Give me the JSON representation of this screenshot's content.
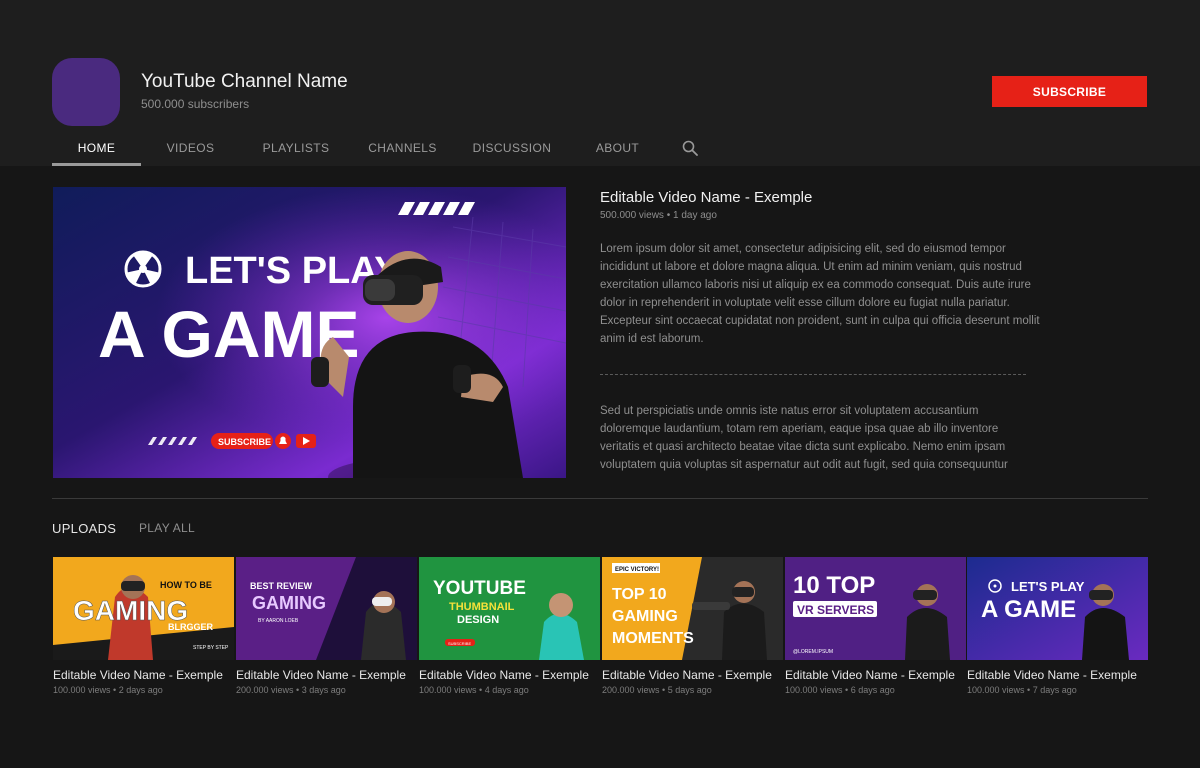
{
  "channel": {
    "name": "YouTube Channel Name",
    "subscribers": "500.000 subscribers",
    "subscribe_label": "SUBSCRIBE",
    "avatar_color": "#4a2a7f"
  },
  "tabs": [
    {
      "label": "HOME",
      "active": true
    },
    {
      "label": "VIDEOS",
      "active": false
    },
    {
      "label": "PLAYLISTS",
      "active": false
    },
    {
      "label": "CHANNELS",
      "active": false
    },
    {
      "label": "DISCUSSION",
      "active": false
    },
    {
      "label": "ABOUT",
      "active": false
    }
  ],
  "search_icon": "search-icon",
  "featured": {
    "title": "Editable Video Name - Exemple",
    "meta": "500.000 views • 1 day ago",
    "thumb_text_1": "LET'S PLAY",
    "thumb_text_2": "A GAME",
    "thumb_subscribe": "SUBSCRIBE",
    "description_1": "Lorem ipsum dolor sit amet, consectetur adipisicing elit, sed do eiusmod tempor incididunt ut labore et dolore magna aliqua. Ut enim ad minim veniam, quis nostrud exercitation ullamco laboris nisi ut aliquip ex ea commodo consequat. Duis aute irure dolor in reprehenderit in voluptate velit esse cillum dolore eu fugiat nulla pariatur. Excepteur sint occaecat cupidatat non proident, sunt in culpa qui officia deserunt mollit anim id est laborum.",
    "description_2": "Sed ut perspiciatis unde omnis iste natus error sit voluptatem accusantium doloremque laudantium, totam rem aperiam, eaque ipsa quae ab illo inventore veritatis et quasi architecto beatae vitae dicta sunt explicabo. Nemo enim ipsam voluptatem quia voluptas sit aspernatur aut odit aut fugit, sed quia consequuntur"
  },
  "uploads": {
    "title": "UPLOADS",
    "play_all": "PLAY ALL",
    "videos": [
      {
        "title": "Editable Video Name - Exemple",
        "meta": "100.000 views • 2 days ago",
        "thumb_lines": [
          "HOW TO BE",
          "GAMING",
          "BLRGGER"
        ],
        "thumb_tag": "STEP BY STEP",
        "colors": [
          "#f2a81d",
          "#1a1a1a"
        ]
      },
      {
        "title": "Editable Video Name - Exemple",
        "meta": "200.000 views • 3 days ago",
        "thumb_lines": [
          "BEST REVIEW",
          "GAMING",
          "BY AARON LOEB"
        ],
        "thumb_tag": "",
        "colors": [
          "#5a1f86",
          "#1e0f3a"
        ]
      },
      {
        "title": "Editable Video Name - Exemple",
        "meta": "100.000 views • 4 days ago",
        "thumb_lines": [
          "YOUTUBE",
          "THUMBNAIL",
          "DESIGN"
        ],
        "thumb_tag": "SUBSCRIBE",
        "colors": [
          "#27a84a",
          "#0f5a26"
        ]
      },
      {
        "title": "Editable Video Name - Exemple",
        "meta": "200.000 views • 5 days ago",
        "thumb_lines": [
          "EPIC VICTORY!",
          "TOP 10",
          "GAMING",
          "MOMENTS"
        ],
        "thumb_tag": "",
        "colors": [
          "#f2a81d",
          "#2a2a2a"
        ]
      },
      {
        "title": "Editable Video Name - Exemple",
        "meta": "100.000 views • 6 days ago",
        "thumb_lines": [
          "10 TOP",
          "VR SERVERS",
          "@LOREM.IPSUM"
        ],
        "thumb_tag": "",
        "colors": [
          "#6b2aa6",
          "#2a1250"
        ]
      },
      {
        "title": "Editable Video Name - Exemple",
        "meta": "100.000 views • 7 days ago",
        "thumb_lines": [
          "LET'S PLAY",
          "A GAME"
        ],
        "thumb_tag": "",
        "colors": [
          "#2b3bb8",
          "#6a2ac0"
        ]
      }
    ]
  }
}
